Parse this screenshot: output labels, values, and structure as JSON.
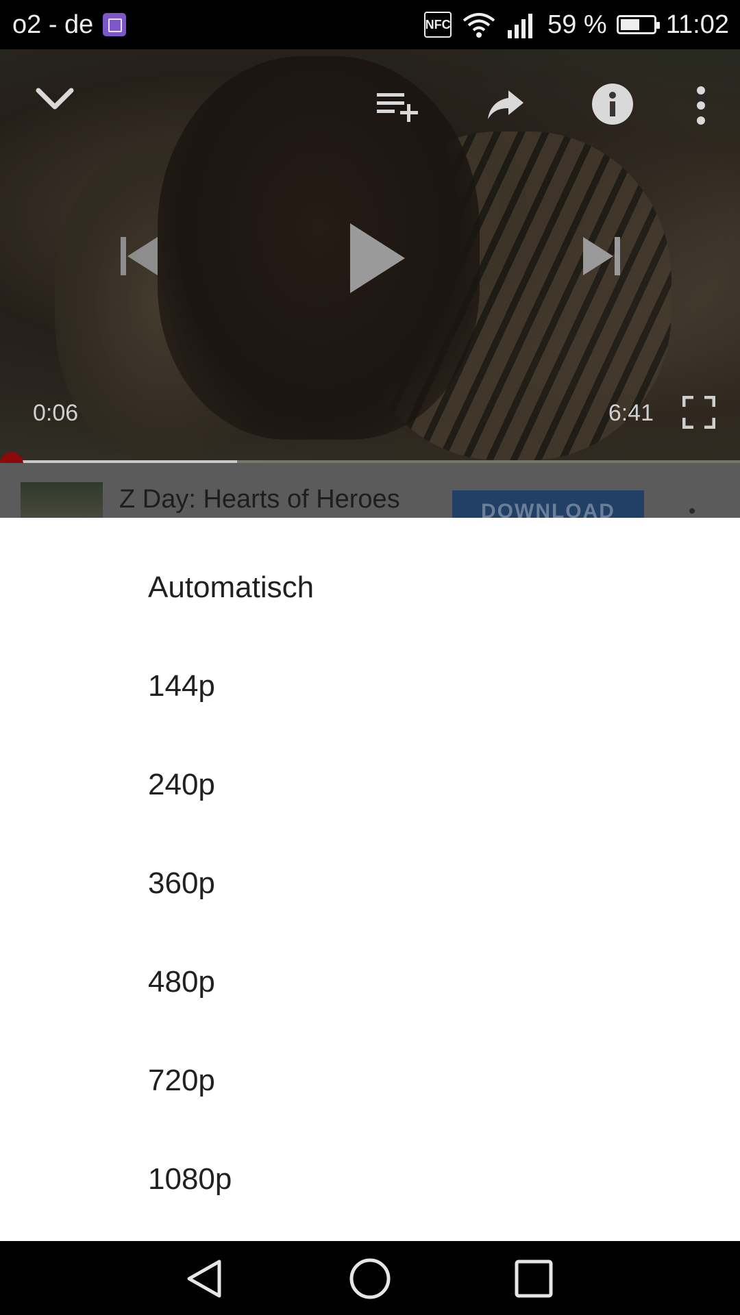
{
  "status_bar": {
    "carrier": "o2 - de",
    "nfc_label": "NFC",
    "battery_percent": "59 %",
    "battery_level": 0.59,
    "time": "11:02",
    "icons": [
      "gallery-notification-icon",
      "nfc-icon",
      "wifi-icon",
      "signal-icon",
      "battery-icon"
    ]
  },
  "player": {
    "current_time": "0:06",
    "duration": "6:41",
    "progress_fraction": 0.015,
    "buffered_fraction": 0.32,
    "accent_color": "#cc0000",
    "icons": [
      "chevron-down-icon",
      "add-to-queue-icon",
      "share-icon",
      "info-icon",
      "more-vert-icon",
      "skip-previous-icon",
      "play-icon",
      "skip-next-icon",
      "fullscreen-icon"
    ]
  },
  "ad": {
    "title": "Z Day: Hearts of Heroes",
    "button_label": "DOWNLOAD"
  },
  "quality_menu": {
    "options": [
      {
        "label": "Automatisch"
      },
      {
        "label": "144p"
      },
      {
        "label": "240p"
      },
      {
        "label": "360p"
      },
      {
        "label": "480p"
      },
      {
        "label": "720p"
      },
      {
        "label": "1080p"
      }
    ]
  },
  "nav_bar": {
    "icons": [
      "back-icon",
      "home-icon",
      "recent-apps-icon"
    ]
  }
}
